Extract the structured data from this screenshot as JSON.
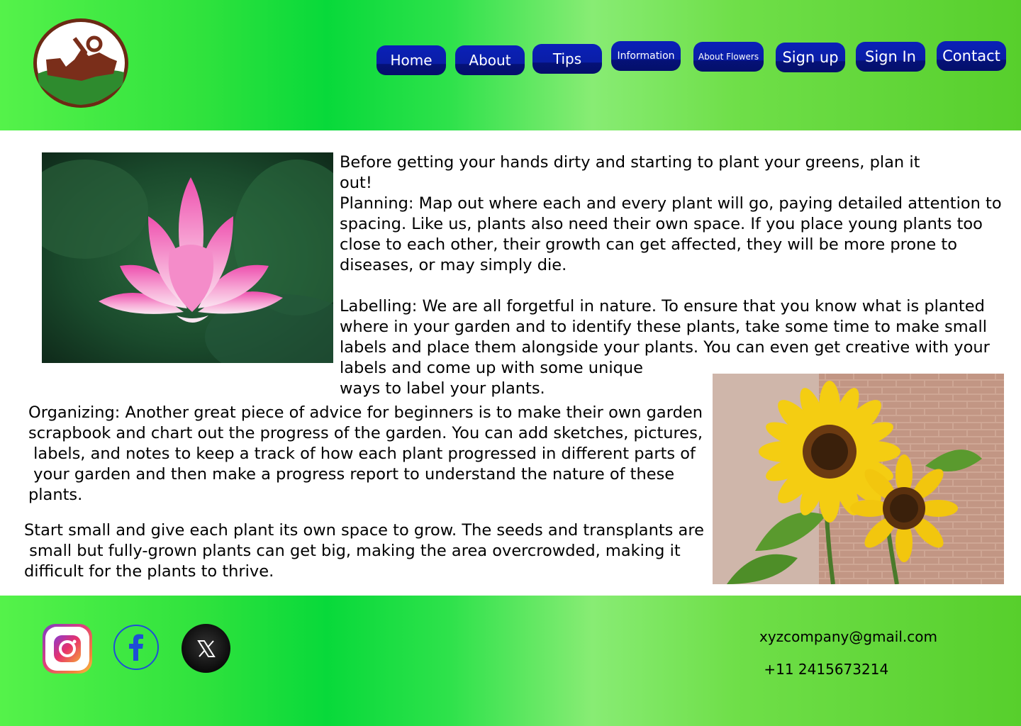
{
  "nav": {
    "home": "Home",
    "about": "About",
    "tips": "Tips",
    "information": "Information",
    "about_flowers": "About Flowers",
    "signup": "Sign up",
    "signin": "Sign In",
    "contact": "Contact"
  },
  "content": {
    "intro_line1": "Before getting your hands dirty and starting to plant your greens, plan it",
    "intro_line2": "out!",
    "planning_1": "Planning: Map out where each and every plant will go, paying detailed attention to",
    "planning_2": "spacing. Like us, plants also need their own space. If you place young plants too",
    "planning_3": "close to each other, their growth can get affected, they will be more prone to",
    "planning_4": "diseases, or may simply die.",
    "labelling_1": "Labelling: We are all forgetful in nature. To ensure that you know what is planted",
    "labelling_2": "where in your garden and to identify these plants, take some time to make small",
    "labelling_3": "labels and place them alongside your plants. You can even get creative with your",
    "labelling_4": "labels and come up with some unique",
    "labelling_5": "ways to label your plants.",
    "organizing_1": "Organizing: Another great piece of advice for beginners is to make their own garden",
    "organizing_2": "scrapbook and chart out the progress of the garden. You can add sketches, pictures,",
    "organizing_3": " labels, and notes to keep a track of how each plant progressed in different parts of",
    "organizing_4": " your garden and then make a progress report to understand the nature of these",
    "organizing_5": "plants.",
    "start_1": "Start small and give each plant its own space to grow. The seeds and transplants are",
    "start_2": " small but fully-grown plants can get big, making the area overcrowded, making it",
    "start_3": "difficult for the plants to thrive."
  },
  "footer": {
    "email": "xyzcompany@gmail.com",
    "phone": " +11 2415673214"
  },
  "icons": {
    "logo": "gardening-logo",
    "instagram": "instagram-icon",
    "facebook": "facebook-icon",
    "x": "x-icon"
  },
  "colors": {
    "nav_button": "#0a1ea6",
    "header_green": "#08d93a",
    "logo_brown": "#7a2e1a"
  }
}
